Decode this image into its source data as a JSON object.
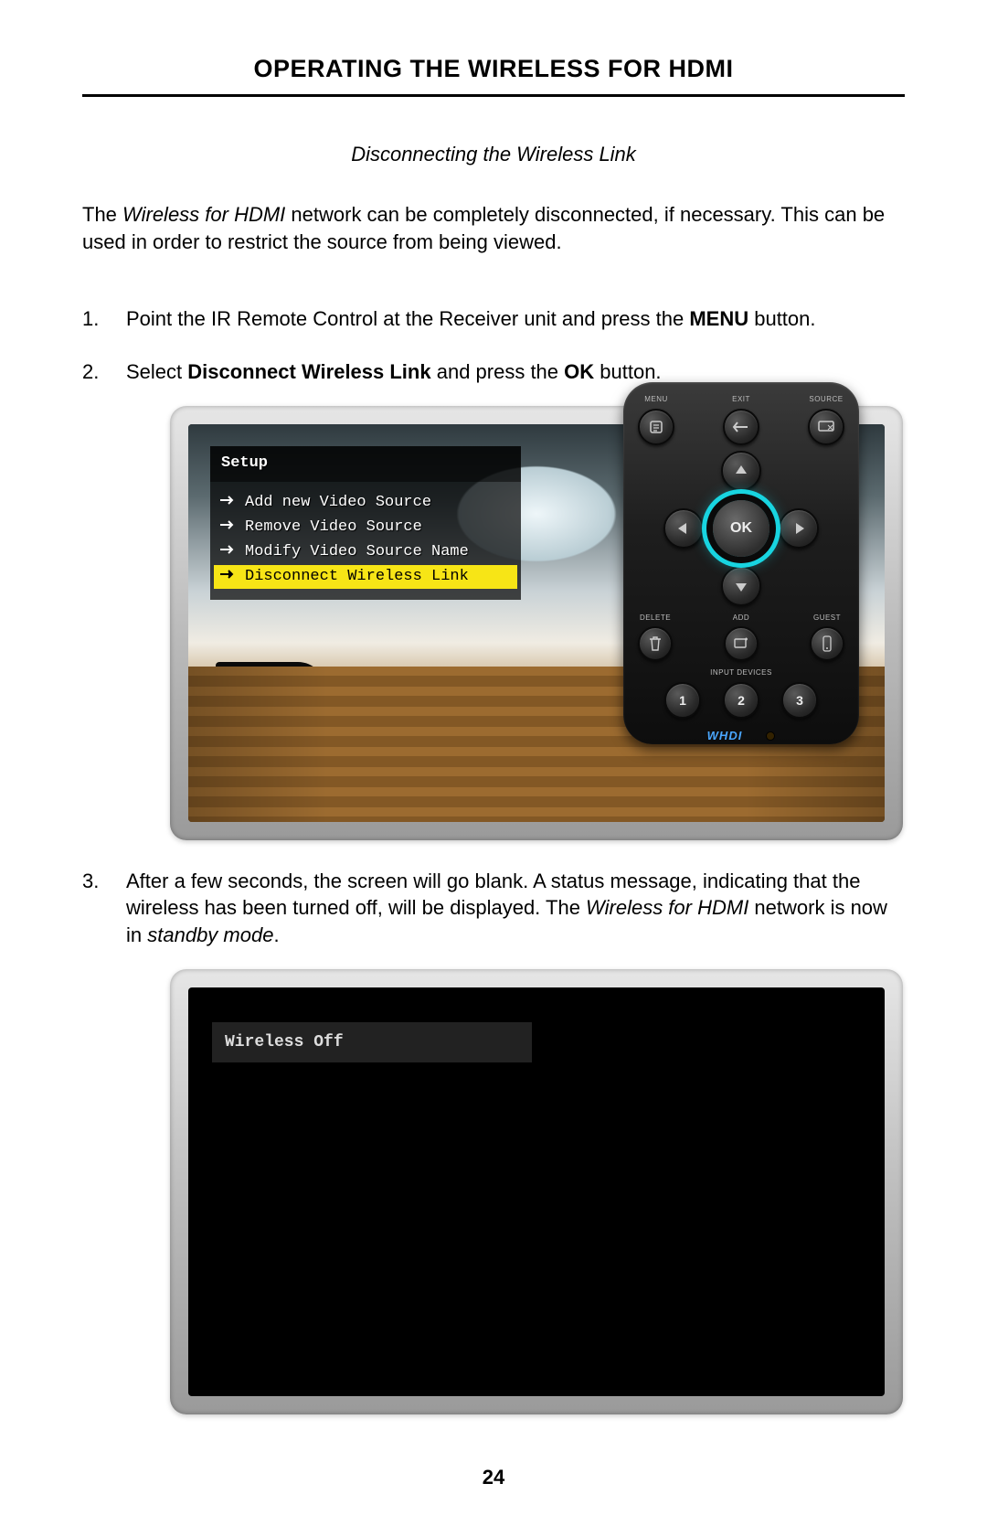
{
  "page": {
    "title": "OPERATING THE WIRELESS FOR HDMI",
    "subtitle": "Disconnecting the Wireless Link",
    "page_number": "24"
  },
  "intro": {
    "pre": "The ",
    "product": "Wireless for HDMI",
    "post": " network can be completely disconnected, if necessary. This can be used in order to restrict the source from being viewed."
  },
  "steps": {
    "s1": {
      "pre": "Point the IR Remote Control at the Receiver unit and press the ",
      "bold": "MENU",
      "post": " button."
    },
    "s2": {
      "pre": "Select ",
      "bold": "Disconnect Wireless Link",
      "mid": " and press the ",
      "bold2": "OK",
      "post": " button."
    },
    "s3": {
      "pre": "After a few seconds, the screen will go blank.  A status message, indicating that the wireless has been turned off, will be displayed.  The ",
      "product": "Wireless for HDMI",
      "mid": " network is now in ",
      "mode": "standby mode",
      "post": "."
    }
  },
  "osd": {
    "title": "Setup",
    "items": [
      "Add new Video Source",
      "Remove Video Source",
      "Modify Video Source Name",
      "Disconnect Wireless Link"
    ],
    "selected_index": 3
  },
  "osd2": {
    "message": "Wireless Off"
  },
  "remote": {
    "labels": {
      "menu": "MENU",
      "exit": "EXIT",
      "source": "SOURCE",
      "delete": "DELETE",
      "add": "ADD",
      "guest": "GUEST",
      "input_devices": "INPUT DEVICES"
    },
    "ok": "OK",
    "numbers": [
      "1",
      "2",
      "3"
    ],
    "brand": "WHDI"
  }
}
